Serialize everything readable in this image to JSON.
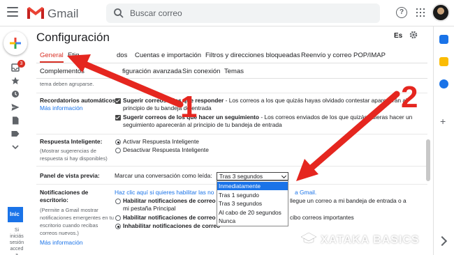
{
  "app": {
    "name": "Gmail"
  },
  "search": {
    "placeholder": "Buscar correo"
  },
  "rail": {
    "inbox_badge": "3",
    "start_button": "Inic",
    "note": "Si iniciás sesión acced a"
  },
  "page": {
    "title": "Configuración",
    "language": "Es"
  },
  "tabs": [
    "General",
    "Etiquetas",
    "Recibidos",
    "Cuentas e importación",
    "Filtros y direcciones bloqueadas",
    "Reenvío y correo POP/IMAP"
  ],
  "tabs2": [
    "Complementos",
    "Configuración avanzada",
    "Sin conexión",
    "Temas"
  ],
  "tab_prefix_partial": "Etiq",
  "tab_partial_1": "dos",
  "tab2_partial": "figuración avanzada",
  "settings": {
    "cut_top": "tema deben agruparse.",
    "nudges": {
      "label": "Recordatorios automáticos:",
      "more": "Más información",
      "opt1_bold": "Sugerir correos a los que responder",
      "opt1_rest": " - Los correos a los que quizás hayas olvidado contestar aparecerán al",
      "opt1_line2": "principio de tu bandeja de entrada",
      "opt2_bold": "Sugerir correos de los que hacer un seguimiento",
      "opt2_rest": " - Los correos enviados de los que quizás quieras hacer un",
      "opt2_line2": "seguimiento aparecerán al principio de tu bandeja de entrada"
    },
    "smart_reply": {
      "label": "Respuesta Inteligente:",
      "desc1": "(Mostrar sugerencias de",
      "desc2": "respuesta si hay disponibles)",
      "on": "Activar Respuesta Inteligente",
      "off": "Desactivar Respuesta Inteligente"
    },
    "preview": {
      "label": "Panel de vista previa:",
      "mark_label": "Marcar una conversación como leída:",
      "selected": "Tras 3 segundos",
      "options": [
        "Inmediatamente",
        "Tras 1 segundo",
        "Tras 3 segundos",
        "Al cabo de 20 segundos",
        "Nunca"
      ]
    },
    "notifications": {
      "label1": "Notificaciones de",
      "label2": "escritorio:",
      "desc1": "(Permite a Gmail mostrar",
      "desc2": "notificaciones emergentes en tu",
      "desc3": "escritorio cuando recibas",
      "desc4": "correos nuevos.)",
      "more": "Más información",
      "link": "Haz clic aquí si quieres habilitar las no",
      "link_end": "a Gmail.",
      "opt1": "Habilitar notificaciones de correo n",
      "opt1_end": "llegue un correo a mi bandeja de entrada o a",
      "opt1_line2": "mi pestaña Principal",
      "opt2": "Habilitar notificaciones de correo i",
      "opt2_end": "cibo correos importantes",
      "opt3": "Inhabilitar notificaciones de correo"
    }
  },
  "watermark": "XATAKA BASICS",
  "annotations": {
    "arrow1_number": "1",
    "arrow2_number": "2"
  },
  "colors": {
    "accent_red": "#d93025",
    "link_blue": "#1a73e8",
    "annotation_red": "#e5261f"
  }
}
